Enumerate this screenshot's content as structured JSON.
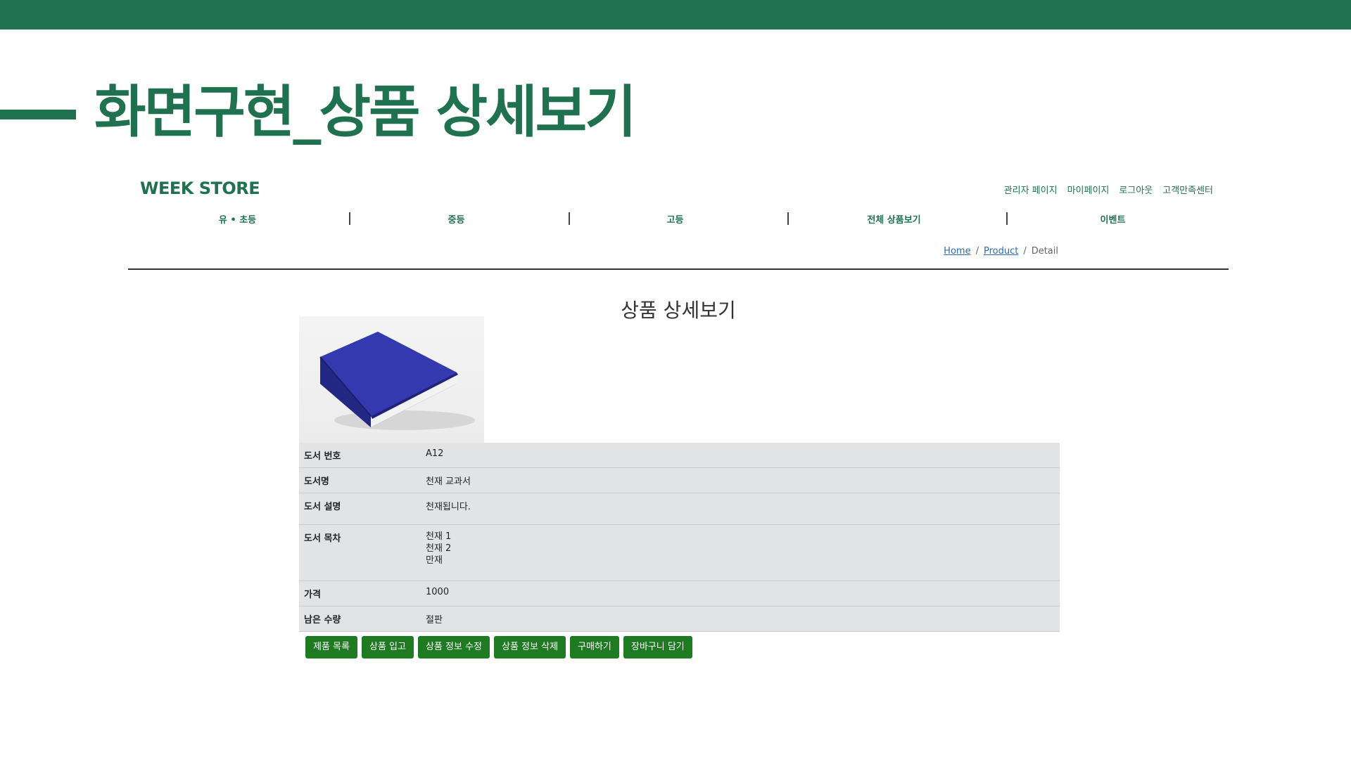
{
  "slide": {
    "title": "화면구현_상품 상세보기"
  },
  "site": {
    "logo": "WEEK STORE",
    "util_links": [
      "관리자 페이지",
      "마이페이지",
      "로그아웃",
      "고객만족센터"
    ],
    "nav": [
      "유 • 초등",
      "중등",
      "고등",
      "전체 상품보기",
      "이벤트"
    ],
    "breadcrumb": {
      "home": "Home",
      "product": "Product",
      "current": "Detail",
      "separator": "/"
    }
  },
  "detail": {
    "heading": "상품 상세보기",
    "image_alt": "blue-book-image",
    "rows": [
      {
        "label": "도서 번호",
        "value": "A12"
      },
      {
        "label": "도서명",
        "value": "천재 교과서"
      },
      {
        "label": "도서 설명",
        "value": "천재됩니다."
      },
      {
        "label": "도서 목차",
        "lines": [
          "천재 1",
          "천재 2",
          "만재"
        ]
      },
      {
        "label": "가격",
        "value": "1000"
      },
      {
        "label": "남은 수량",
        "value": "절판"
      }
    ]
  },
  "buttons": {
    "list": "제품 목록",
    "stock_in": "상품 입고",
    "edit": "상품 정보 수정",
    "delete": "상품 정보 삭제",
    "buy": "구매하기",
    "cart": "장바구니 담기"
  },
  "colors": {
    "brand": "#1f7150",
    "button": "#1e7b22",
    "table_bg": "#e2e3e5",
    "link": "#2b6cb0"
  }
}
